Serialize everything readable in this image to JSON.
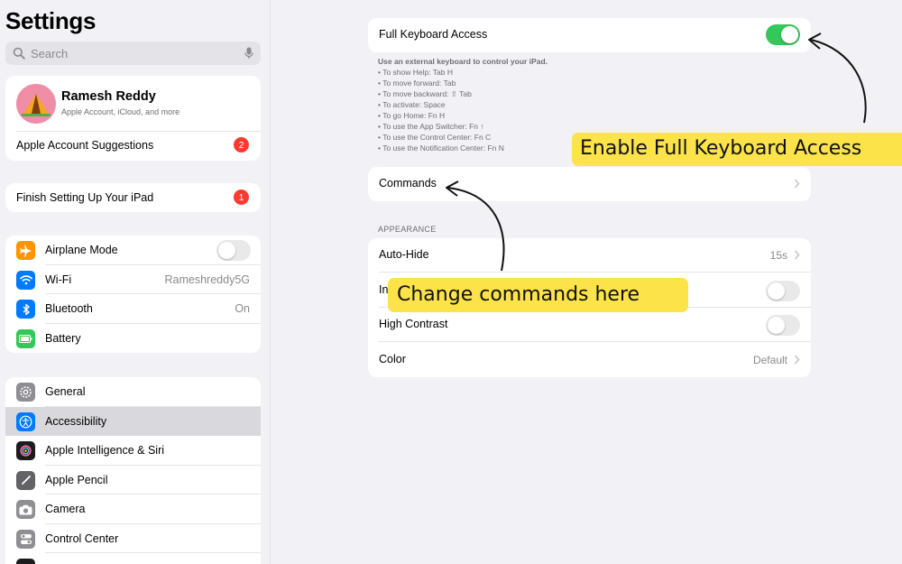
{
  "sidebar": {
    "title": "Settings",
    "search_placeholder": "Search",
    "profile": {
      "name": "Ramesh Reddy",
      "subtitle": "Apple Account, iCloud, and more",
      "suggestions_label": "Apple Account Suggestions",
      "suggestions_badge": "2"
    },
    "finish_setup": {
      "label": "Finish Setting Up Your iPad",
      "badge": "1"
    },
    "group1": [
      {
        "label": "Airplane Mode",
        "icon": "airplane-icon",
        "color": "#ff9500"
      },
      {
        "label": "Wi-Fi",
        "value": "Rameshreddy5G",
        "icon": "wifi-icon",
        "color": "#007aff"
      },
      {
        "label": "Bluetooth",
        "value": "On",
        "icon": "bluetooth-icon",
        "color": "#007aff"
      },
      {
        "label": "Battery",
        "icon": "battery-icon",
        "color": "#34c759"
      }
    ],
    "group2": [
      {
        "label": "General",
        "icon": "gear-icon",
        "color": "#8e8e93"
      },
      {
        "label": "Accessibility",
        "icon": "accessibility-icon",
        "color": "#007aff",
        "selected": true
      },
      {
        "label": "Apple Intelligence & Siri",
        "icon": "siri-icon",
        "color": "#1c1c1e"
      },
      {
        "label": "Apple Pencil",
        "icon": "pencil-icon",
        "color": "#636366"
      },
      {
        "label": "Camera",
        "icon": "camera-icon",
        "color": "#8e8e93"
      },
      {
        "label": "Control Center",
        "icon": "switches-icon",
        "color": "#8e8e93"
      }
    ]
  },
  "main": {
    "full_keyboard_access": {
      "label": "Full Keyboard Access",
      "enabled": true
    },
    "help": {
      "title": "Use an external keyboard to control your iPad.",
      "items": [
        "To show Help: Tab H",
        "To move forward: Tab",
        "To move backward: ⇧ Tab",
        "To activate: Space",
        "To go Home: Fn H",
        "To use the App Switcher: Fn ↑",
        "To use the Control Center: Fn C",
        "To use the Notification Center: Fn N"
      ]
    },
    "commands_label": "Commands",
    "appearance_header": "APPEARANCE",
    "appearance": {
      "auto_hide": {
        "label": "Auto-Hide",
        "value": "15s"
      },
      "increase_size": {
        "label": "In",
        "enabled": false
      },
      "high_contrast": {
        "label": "High Contrast",
        "enabled": false
      },
      "color": {
        "label": "Color",
        "value": "Default"
      }
    }
  },
  "annotations": {
    "callout_enable": "Enable Full Keyboard Access",
    "callout_commands": "Change commands here",
    "highlight_color": "#fce34a"
  }
}
